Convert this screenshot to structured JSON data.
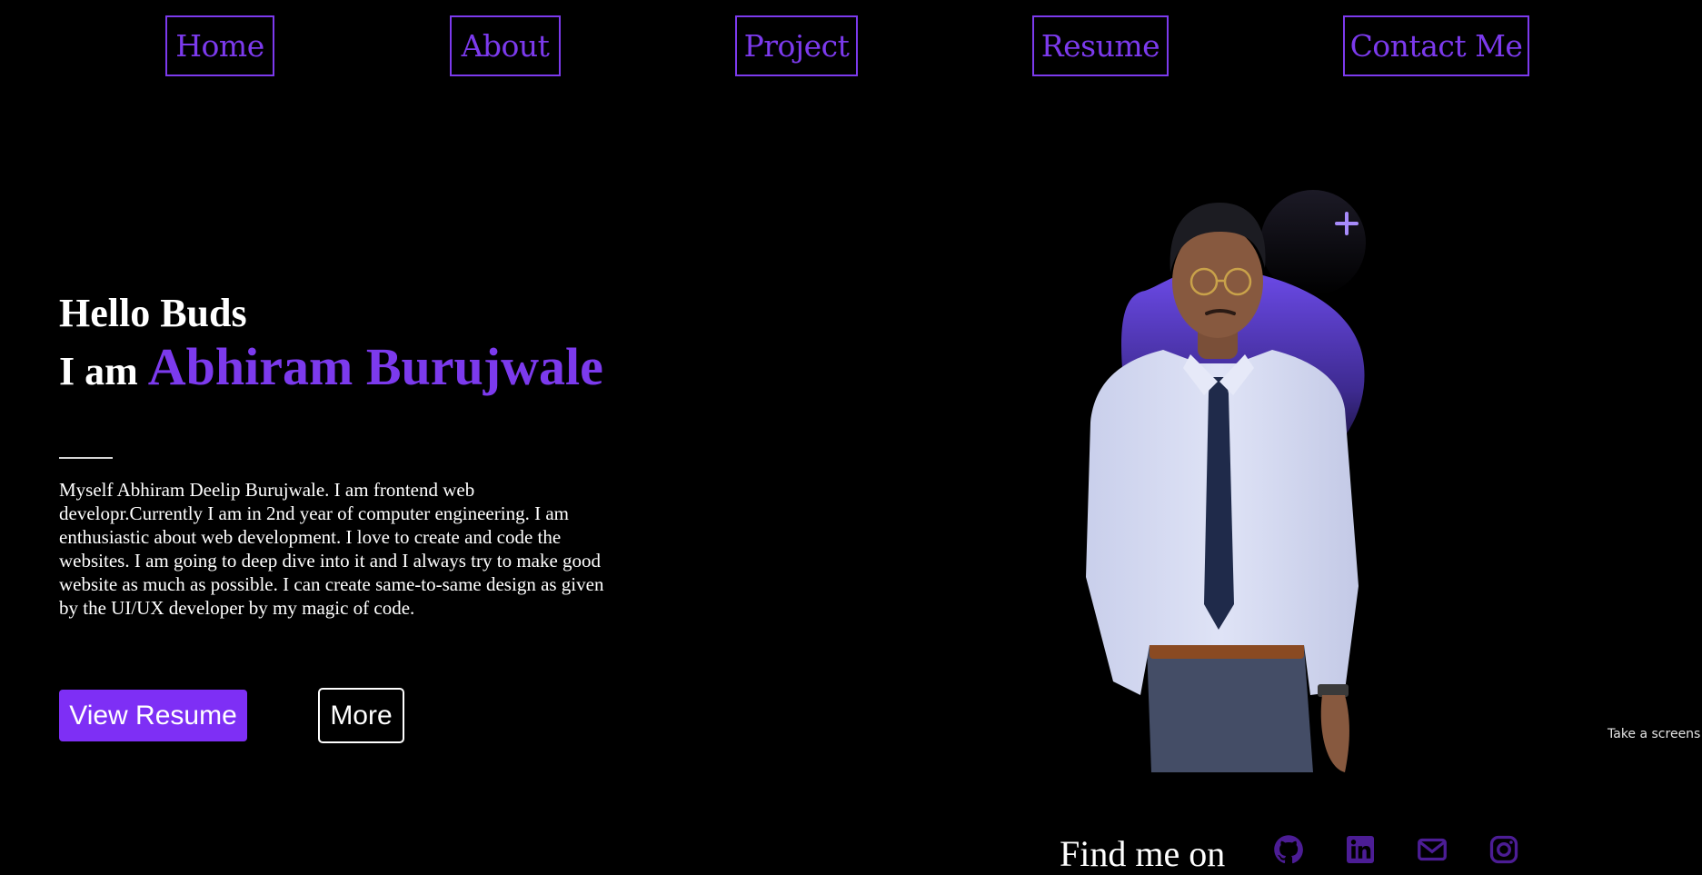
{
  "nav": {
    "items": [
      {
        "label": "Home"
      },
      {
        "label": "About"
      },
      {
        "label": "Project"
      },
      {
        "label": "Resume"
      },
      {
        "label": "Contact Me"
      }
    ]
  },
  "hero": {
    "greeting": "Hello Buds",
    "intro_prefix": "I am",
    "name": "Abhiram Burujwale",
    "bio": "Myself Abhiram Deelip Burujwale. I am frontend web developr.Currently I am in 2nd year of computer engineering. I am enthusiastic about web development. I love to create and code the websites. I am going to deep dive into it and I always try to make good website as much as possible. I can create same-to-same design as given by the UI/UX developer by my magic of code.",
    "primary_button": "View Resume",
    "secondary_button": "More"
  },
  "screenshot_tip": "Take a screens",
  "social": {
    "label": "Find me on",
    "icons": [
      "github-icon",
      "linkedin-icon",
      "mail-icon",
      "instagram-icon"
    ]
  },
  "colors": {
    "accent": "#7c3aed",
    "button": "#7e2ff5",
    "background": "#000000",
    "social_icon": "#4c1d95"
  }
}
